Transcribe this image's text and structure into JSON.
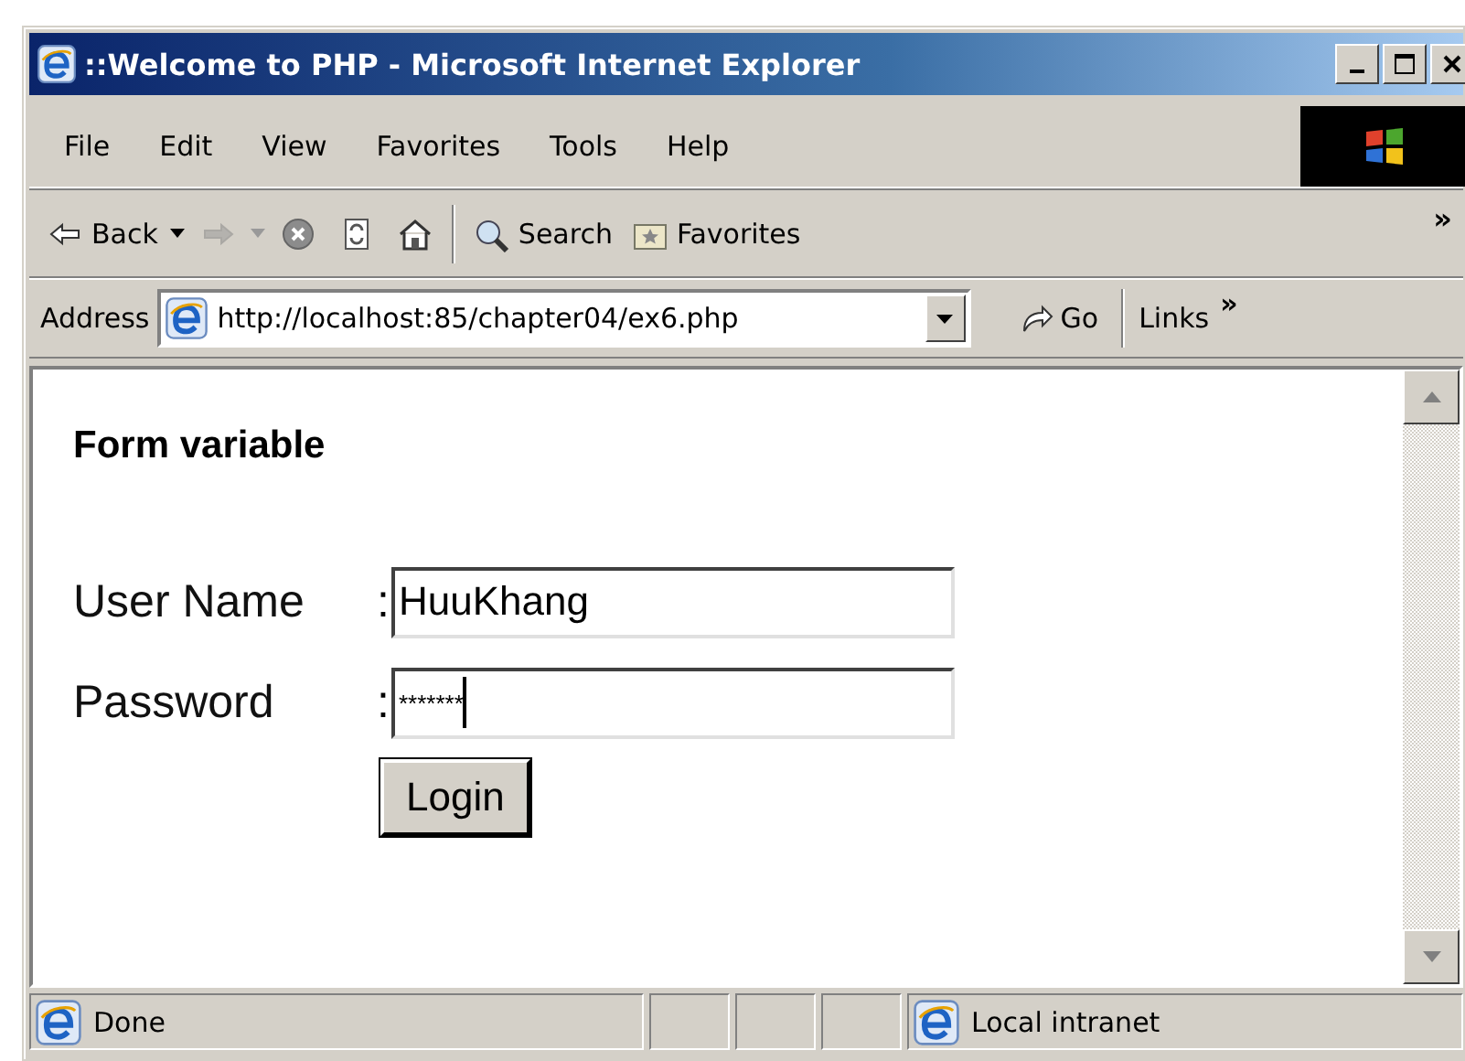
{
  "window": {
    "title": "::Welcome to PHP - Microsoft Internet Explorer"
  },
  "menu": [
    {
      "label": "File"
    },
    {
      "label": "Edit"
    },
    {
      "label": "View"
    },
    {
      "label": "Favorites"
    },
    {
      "label": "Tools"
    },
    {
      "label": "Help"
    }
  ],
  "toolbar": {
    "buttons": [
      {
        "kind": "back",
        "label": "Back",
        "disabled": false
      },
      {
        "kind": "forward",
        "disabled": true
      },
      {
        "kind": "stop",
        "disabled": false
      },
      {
        "kind": "refresh",
        "disabled": false
      },
      {
        "kind": "home",
        "disabled": false
      },
      {
        "kind": "search",
        "label": "Search",
        "disabled": false
      },
      {
        "kind": "favorites",
        "label": "Favorites",
        "disabled": false
      }
    ],
    "chevron": "»"
  },
  "address_bar": {
    "label": "Address",
    "url": "http://localhost:85/chapter04/ex6.php",
    "go": "Go",
    "links": "Links",
    "chevron": "»"
  },
  "page": {
    "heading": "Form variable",
    "fields": [
      {
        "label": "User Name",
        "colon": ":",
        "value": "HuuKhang",
        "focused": false
      },
      {
        "label": "Password",
        "colon": ":",
        "value": "*******",
        "focused": true
      }
    ],
    "button": "Login"
  },
  "status_bar": {
    "text": "Done",
    "zone": "Local intranet"
  }
}
